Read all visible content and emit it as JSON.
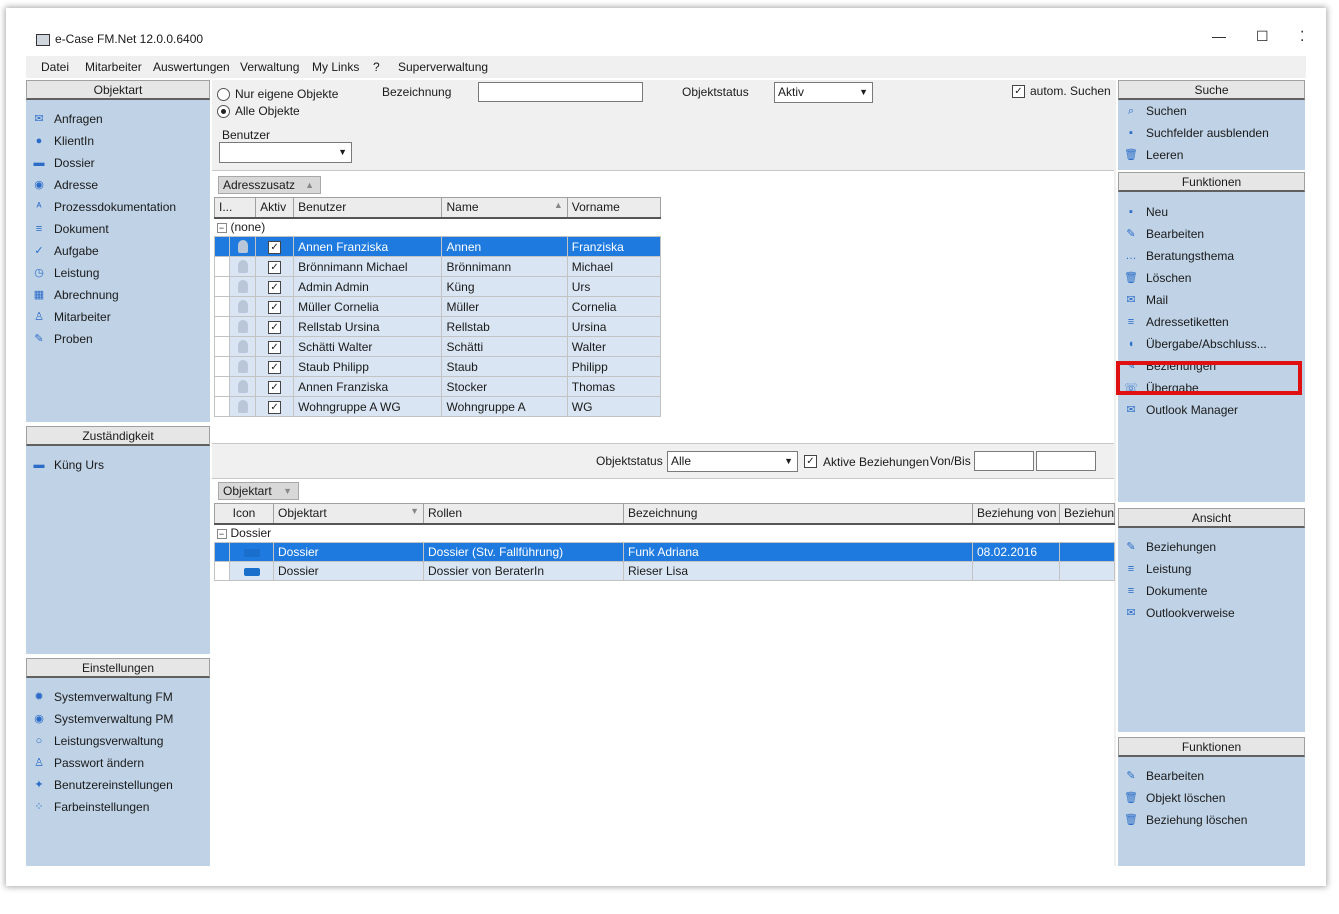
{
  "window": {
    "title": "e-Case FM.Net 12.0.0.6400",
    "controls": {
      "minimize": "—",
      "maximize": "☐",
      "close": "⁚"
    }
  },
  "menu": [
    "Datei",
    "Mitarbeiter",
    "Auswertungen",
    "Verwaltung",
    "My Links",
    "?",
    "Superverwaltung"
  ],
  "left": {
    "objektart": {
      "header": "Objektart",
      "items": [
        {
          "label": "Anfragen",
          "icon": "mail-icon"
        },
        {
          "label": "KlientIn",
          "icon": "person-icon"
        },
        {
          "label": "Dossier",
          "icon": "dossier-icon"
        },
        {
          "label": "Adresse",
          "icon": "lifebuoy-icon"
        },
        {
          "label": "Prozessdokumentation",
          "icon": "abc-icon"
        },
        {
          "label": "Dokument",
          "icon": "document-icon"
        },
        {
          "label": "Aufgabe",
          "icon": "checkmark-icon"
        },
        {
          "label": "Leistung",
          "icon": "clock-icon"
        },
        {
          "label": "Abrechnung",
          "icon": "calculator-icon"
        },
        {
          "label": "Mitarbeiter",
          "icon": "employee-icon"
        },
        {
          "label": "Proben",
          "icon": "pencil-icon"
        }
      ]
    },
    "zustaendigkeit": {
      "header": "Zuständigkeit",
      "items": [
        {
          "label": "Küng Urs",
          "icon": "dossier-icon"
        }
      ]
    },
    "einstellungen": {
      "header": "Einstellungen",
      "items": [
        {
          "label": "Systemverwaltung FM",
          "icon": "gear-icon"
        },
        {
          "label": "Systemverwaltung PM",
          "icon": "record-icon"
        },
        {
          "label": "Leistungsverwaltung",
          "icon": "circle-icon"
        },
        {
          "label": "Passwort ändern",
          "icon": "user-key-icon"
        },
        {
          "label": "Benutzereinstellungen",
          "icon": "settings-icon"
        },
        {
          "label": "Farbeinstellungen",
          "icon": "palette-icon"
        }
      ]
    }
  },
  "filters": {
    "radio_own": "Nur eigene Objekte",
    "radio_all": "Alle Objekte",
    "bezeichnung_label": "Bezeichnung",
    "bezeichnung_value": "",
    "objektstatus_label": "Objektstatus",
    "objektstatus_value": "Aktiv",
    "autosearch_label": "autom. Suchen",
    "benutzer_label": "Benutzer",
    "benutzer_value": ""
  },
  "upper_grid": {
    "group_by": "Adresszusatz",
    "columns": [
      "I...",
      "Aktiv",
      "Benutzer",
      "Name",
      "Vorname"
    ],
    "group_label": "(none)",
    "rows": [
      {
        "benutzer": "Annen Franziska",
        "name": "Annen",
        "vorname": "Franziska",
        "aktiv": true,
        "selected": true
      },
      {
        "benutzer": "Brönnimann Michael",
        "name": "Brönnimann",
        "vorname": "Michael",
        "aktiv": true,
        "selected": false
      },
      {
        "benutzer": "Admin Admin",
        "name": "Küng",
        "vorname": "Urs",
        "aktiv": true,
        "selected": false
      },
      {
        "benutzer": "Müller Cornelia",
        "name": "Müller",
        "vorname": "Cornelia",
        "aktiv": true,
        "selected": false
      },
      {
        "benutzer": "Rellstab Ursina",
        "name": "Rellstab",
        "vorname": "Ursina",
        "aktiv": true,
        "selected": false
      },
      {
        "benutzer": "Schätti Walter",
        "name": "Schätti",
        "vorname": "Walter",
        "aktiv": true,
        "selected": false
      },
      {
        "benutzer": "Staub Philipp",
        "name": "Staub",
        "vorname": "Philipp",
        "aktiv": true,
        "selected": false
      },
      {
        "benutzer": "Annen Franziska",
        "name": "Stocker",
        "vorname": "Thomas",
        "aktiv": true,
        "selected": false
      },
      {
        "benutzer": "Wohngruppe A WG",
        "name": "Wohngruppe A",
        "vorname": "WG",
        "aktiv": true,
        "selected": false
      }
    ]
  },
  "lower_filters": {
    "objektstatus_label": "Objektstatus",
    "objektstatus_value": "Alle",
    "aktive_label": "Aktive Beziehungen",
    "vonbis_label": "Von/Bis"
  },
  "lower_grid": {
    "group_by": "Objektart",
    "columns": [
      "Icon",
      "Objektart",
      "Rollen",
      "Bezeichnung",
      "Beziehung von",
      "Beziehung"
    ],
    "group_label": "Dossier",
    "rows": [
      {
        "objektart": "Dossier",
        "rollen": "Dossier (Stv. Fallführung)",
        "bezeichnung": "Funk Adriana",
        "von": "08.02.2016",
        "bis": "",
        "selected": true
      },
      {
        "objektart": "Dossier",
        "rollen": "Dossier von BeraterIn",
        "bezeichnung": "Rieser Lisa",
        "von": "",
        "bis": "",
        "selected": false
      }
    ]
  },
  "right": {
    "suche": {
      "header": "Suche",
      "items": [
        {
          "label": "Suchen",
          "icon": "magnifier-icon"
        },
        {
          "label": "Suchfelder ausblenden",
          "icon": "hide-icon"
        },
        {
          "label": "Leeren",
          "icon": "trash-icon"
        }
      ]
    },
    "funktionen": {
      "header": "Funktionen",
      "items": [
        {
          "label": "Neu",
          "icon": "new-icon"
        },
        {
          "label": "Bearbeiten",
          "icon": "pencil-icon"
        },
        {
          "label": "Beratungsthema",
          "icon": "speech-icon"
        },
        {
          "label": "Löschen",
          "icon": "trash-icon"
        },
        {
          "label": "Mail",
          "icon": "mail-icon"
        },
        {
          "label": "Adressetiketten",
          "icon": "document-icon"
        },
        {
          "label": "Übergabe/Abschluss...",
          "icon": "bulb-icon"
        },
        {
          "label": "Beziehungen",
          "icon": "pencil-icon"
        },
        {
          "label": "Übergabe",
          "icon": "phone-icon"
        },
        {
          "label": "Outlook Manager",
          "icon": "mail-icon"
        }
      ]
    },
    "ansicht": {
      "header": "Ansicht",
      "items": [
        {
          "label": "Beziehungen",
          "icon": "pencil-icon"
        },
        {
          "label": "Leistung",
          "icon": "document-icon"
        },
        {
          "label": "Dokumente",
          "icon": "document-icon"
        },
        {
          "label": "Outlookverweise",
          "icon": "mail-icon"
        }
      ]
    },
    "funktionen2": {
      "header": "Funktionen",
      "items": [
        {
          "label": "Bearbeiten",
          "icon": "pencil-icon"
        },
        {
          "label": "Objekt löschen",
          "icon": "trash-icon"
        },
        {
          "label": "Beziehung löschen",
          "icon": "trash-icon"
        }
      ]
    }
  },
  "highlight_color": "#e01010",
  "selection_color": "#1f7ae0"
}
